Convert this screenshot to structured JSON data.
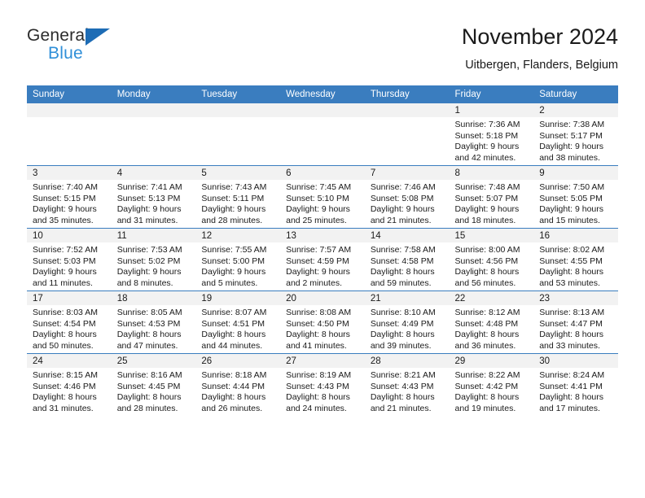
{
  "brand": {
    "name_part1": "General",
    "name_part2": "Blue",
    "logo_icon": "blue-triangle-icon"
  },
  "header": {
    "title": "November 2024",
    "location": "Uitbergen, Flanders, Belgium"
  },
  "calendar": {
    "weekday_headers": [
      "Sunday",
      "Monday",
      "Tuesday",
      "Wednesday",
      "Thursday",
      "Friday",
      "Saturday"
    ],
    "accent_color": "#3a7dbf",
    "day_band_color": "#f2f2f2",
    "weeks": [
      [
        {
          "day": "",
          "sunrise": "",
          "sunset": "",
          "daylight_line1": "",
          "daylight_line2": "",
          "empty": true
        },
        {
          "day": "",
          "sunrise": "",
          "sunset": "",
          "daylight_line1": "",
          "daylight_line2": "",
          "empty": true
        },
        {
          "day": "",
          "sunrise": "",
          "sunset": "",
          "daylight_line1": "",
          "daylight_line2": "",
          "empty": true
        },
        {
          "day": "",
          "sunrise": "",
          "sunset": "",
          "daylight_line1": "",
          "daylight_line2": "",
          "empty": true
        },
        {
          "day": "",
          "sunrise": "",
          "sunset": "",
          "daylight_line1": "",
          "daylight_line2": "",
          "empty": true
        },
        {
          "day": "1",
          "sunrise": "Sunrise: 7:36 AM",
          "sunset": "Sunset: 5:18 PM",
          "daylight_line1": "Daylight: 9 hours",
          "daylight_line2": "and 42 minutes.",
          "empty": false
        },
        {
          "day": "2",
          "sunrise": "Sunrise: 7:38 AM",
          "sunset": "Sunset: 5:17 PM",
          "daylight_line1": "Daylight: 9 hours",
          "daylight_line2": "and 38 minutes.",
          "empty": false
        }
      ],
      [
        {
          "day": "3",
          "sunrise": "Sunrise: 7:40 AM",
          "sunset": "Sunset: 5:15 PM",
          "daylight_line1": "Daylight: 9 hours",
          "daylight_line2": "and 35 minutes.",
          "empty": false
        },
        {
          "day": "4",
          "sunrise": "Sunrise: 7:41 AM",
          "sunset": "Sunset: 5:13 PM",
          "daylight_line1": "Daylight: 9 hours",
          "daylight_line2": "and 31 minutes.",
          "empty": false
        },
        {
          "day": "5",
          "sunrise": "Sunrise: 7:43 AM",
          "sunset": "Sunset: 5:11 PM",
          "daylight_line1": "Daylight: 9 hours",
          "daylight_line2": "and 28 minutes.",
          "empty": false
        },
        {
          "day": "6",
          "sunrise": "Sunrise: 7:45 AM",
          "sunset": "Sunset: 5:10 PM",
          "daylight_line1": "Daylight: 9 hours",
          "daylight_line2": "and 25 minutes.",
          "empty": false
        },
        {
          "day": "7",
          "sunrise": "Sunrise: 7:46 AM",
          "sunset": "Sunset: 5:08 PM",
          "daylight_line1": "Daylight: 9 hours",
          "daylight_line2": "and 21 minutes.",
          "empty": false
        },
        {
          "day": "8",
          "sunrise": "Sunrise: 7:48 AM",
          "sunset": "Sunset: 5:07 PM",
          "daylight_line1": "Daylight: 9 hours",
          "daylight_line2": "and 18 minutes.",
          "empty": false
        },
        {
          "day": "9",
          "sunrise": "Sunrise: 7:50 AM",
          "sunset": "Sunset: 5:05 PM",
          "daylight_line1": "Daylight: 9 hours",
          "daylight_line2": "and 15 minutes.",
          "empty": false
        }
      ],
      [
        {
          "day": "10",
          "sunrise": "Sunrise: 7:52 AM",
          "sunset": "Sunset: 5:03 PM",
          "daylight_line1": "Daylight: 9 hours",
          "daylight_line2": "and 11 minutes.",
          "empty": false
        },
        {
          "day": "11",
          "sunrise": "Sunrise: 7:53 AM",
          "sunset": "Sunset: 5:02 PM",
          "daylight_line1": "Daylight: 9 hours",
          "daylight_line2": "and 8 minutes.",
          "empty": false
        },
        {
          "day": "12",
          "sunrise": "Sunrise: 7:55 AM",
          "sunset": "Sunset: 5:00 PM",
          "daylight_line1": "Daylight: 9 hours",
          "daylight_line2": "and 5 minutes.",
          "empty": false
        },
        {
          "day": "13",
          "sunrise": "Sunrise: 7:57 AM",
          "sunset": "Sunset: 4:59 PM",
          "daylight_line1": "Daylight: 9 hours",
          "daylight_line2": "and 2 minutes.",
          "empty": false
        },
        {
          "day": "14",
          "sunrise": "Sunrise: 7:58 AM",
          "sunset": "Sunset: 4:58 PM",
          "daylight_line1": "Daylight: 8 hours",
          "daylight_line2": "and 59 minutes.",
          "empty": false
        },
        {
          "day": "15",
          "sunrise": "Sunrise: 8:00 AM",
          "sunset": "Sunset: 4:56 PM",
          "daylight_line1": "Daylight: 8 hours",
          "daylight_line2": "and 56 minutes.",
          "empty": false
        },
        {
          "day": "16",
          "sunrise": "Sunrise: 8:02 AM",
          "sunset": "Sunset: 4:55 PM",
          "daylight_line1": "Daylight: 8 hours",
          "daylight_line2": "and 53 minutes.",
          "empty": false
        }
      ],
      [
        {
          "day": "17",
          "sunrise": "Sunrise: 8:03 AM",
          "sunset": "Sunset: 4:54 PM",
          "daylight_line1": "Daylight: 8 hours",
          "daylight_line2": "and 50 minutes.",
          "empty": false
        },
        {
          "day": "18",
          "sunrise": "Sunrise: 8:05 AM",
          "sunset": "Sunset: 4:53 PM",
          "daylight_line1": "Daylight: 8 hours",
          "daylight_line2": "and 47 minutes.",
          "empty": false
        },
        {
          "day": "19",
          "sunrise": "Sunrise: 8:07 AM",
          "sunset": "Sunset: 4:51 PM",
          "daylight_line1": "Daylight: 8 hours",
          "daylight_line2": "and 44 minutes.",
          "empty": false
        },
        {
          "day": "20",
          "sunrise": "Sunrise: 8:08 AM",
          "sunset": "Sunset: 4:50 PM",
          "daylight_line1": "Daylight: 8 hours",
          "daylight_line2": "and 41 minutes.",
          "empty": false
        },
        {
          "day": "21",
          "sunrise": "Sunrise: 8:10 AM",
          "sunset": "Sunset: 4:49 PM",
          "daylight_line1": "Daylight: 8 hours",
          "daylight_line2": "and 39 minutes.",
          "empty": false
        },
        {
          "day": "22",
          "sunrise": "Sunrise: 8:12 AM",
          "sunset": "Sunset: 4:48 PM",
          "daylight_line1": "Daylight: 8 hours",
          "daylight_line2": "and 36 minutes.",
          "empty": false
        },
        {
          "day": "23",
          "sunrise": "Sunrise: 8:13 AM",
          "sunset": "Sunset: 4:47 PM",
          "daylight_line1": "Daylight: 8 hours",
          "daylight_line2": "and 33 minutes.",
          "empty": false
        }
      ],
      [
        {
          "day": "24",
          "sunrise": "Sunrise: 8:15 AM",
          "sunset": "Sunset: 4:46 PM",
          "daylight_line1": "Daylight: 8 hours",
          "daylight_line2": "and 31 minutes.",
          "empty": false
        },
        {
          "day": "25",
          "sunrise": "Sunrise: 8:16 AM",
          "sunset": "Sunset: 4:45 PM",
          "daylight_line1": "Daylight: 8 hours",
          "daylight_line2": "and 28 minutes.",
          "empty": false
        },
        {
          "day": "26",
          "sunrise": "Sunrise: 8:18 AM",
          "sunset": "Sunset: 4:44 PM",
          "daylight_line1": "Daylight: 8 hours",
          "daylight_line2": "and 26 minutes.",
          "empty": false
        },
        {
          "day": "27",
          "sunrise": "Sunrise: 8:19 AM",
          "sunset": "Sunset: 4:43 PM",
          "daylight_line1": "Daylight: 8 hours",
          "daylight_line2": "and 24 minutes.",
          "empty": false
        },
        {
          "day": "28",
          "sunrise": "Sunrise: 8:21 AM",
          "sunset": "Sunset: 4:43 PM",
          "daylight_line1": "Daylight: 8 hours",
          "daylight_line2": "and 21 minutes.",
          "empty": false
        },
        {
          "day": "29",
          "sunrise": "Sunrise: 8:22 AM",
          "sunset": "Sunset: 4:42 PM",
          "daylight_line1": "Daylight: 8 hours",
          "daylight_line2": "and 19 minutes.",
          "empty": false
        },
        {
          "day": "30",
          "sunrise": "Sunrise: 8:24 AM",
          "sunset": "Sunset: 4:41 PM",
          "daylight_line1": "Daylight: 8 hours",
          "daylight_line2": "and 17 minutes.",
          "empty": false
        }
      ]
    ]
  }
}
